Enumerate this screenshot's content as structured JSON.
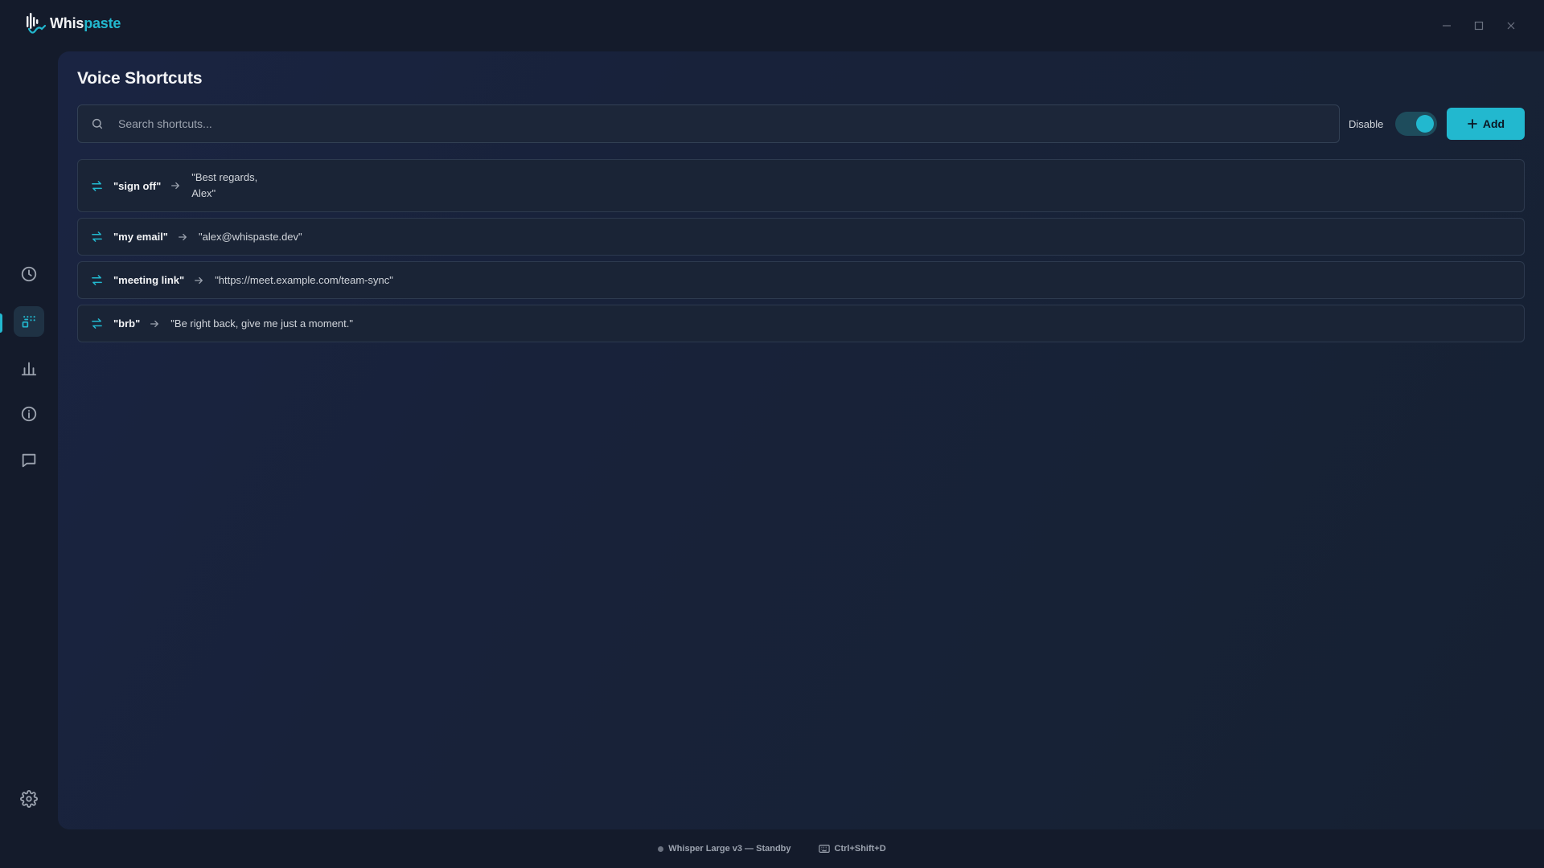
{
  "app": {
    "logo_text_a": "Whis",
    "logo_text_b": "paste",
    "accent": "#22b8cf"
  },
  "window_controls": [
    {
      "name": "minimize-icon"
    },
    {
      "name": "maximize-icon"
    },
    {
      "name": "close-icon"
    }
  ],
  "sidebar": {
    "items": [
      {
        "icon": "clock-icon",
        "label": "History"
      },
      {
        "icon": "shortcuts-icon",
        "label": "Voice Shortcuts",
        "active": true
      },
      {
        "icon": "bar-chart-icon",
        "label": "Stats"
      },
      {
        "icon": "info-icon",
        "label": "About"
      },
      {
        "icon": "message-icon",
        "label": "Feedback"
      }
    ],
    "bottom": {
      "icon": "gear-icon",
      "label": "Settings"
    }
  },
  "page": {
    "title": "Voice Shortcuts",
    "search_placeholder": "Search shortcuts...",
    "disable_label": "Disable",
    "toggle_on": true,
    "add_label": "Add"
  },
  "shortcuts": [
    {
      "trigger": "\"sign off\"",
      "expansion": "\"Best regards,\nAlex\""
    },
    {
      "trigger": "\"my email\"",
      "expansion": "\"alex@whispaste.dev\""
    },
    {
      "trigger": "\"meeting link\"",
      "expansion": "\"https://meet.example.com/team-sync\""
    },
    {
      "trigger": "\"brb\"",
      "expansion": "\"Be right back, give me just a moment.\""
    }
  ],
  "status": {
    "model": "Whisper Large v3 — Standby",
    "hotkey": "Ctrl+Shift+D"
  }
}
